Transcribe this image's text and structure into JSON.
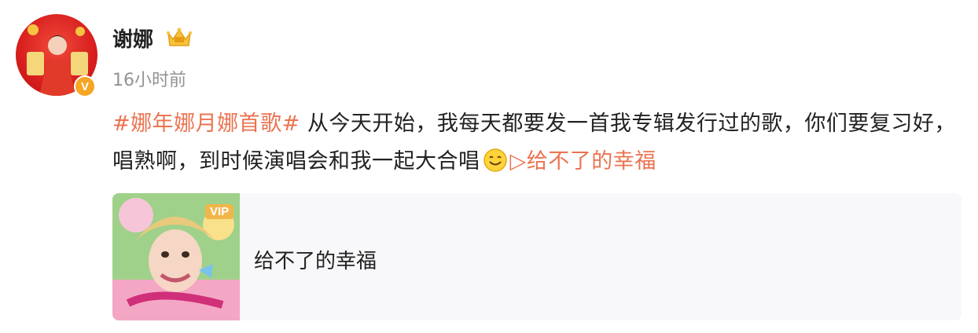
{
  "post": {
    "username": "谢娜",
    "timestamp": "16小时前",
    "hashtag": "#娜年娜月娜首歌#",
    "text_main": " 从今天开始，我每天都要发一首我专辑发行过的歌，你们要复习好，唱熟啊，到时候演唱会和我一起大合唱",
    "music_link_icon": "▷",
    "music_link_label": "给不了的幸福",
    "verified_mark": "V",
    "icons": [
      "crown-badge-icon",
      "verified-icon",
      "smile-emoji-icon",
      "play-icon"
    ]
  },
  "card": {
    "title": "给不了的幸福",
    "vip_badge": "VIP"
  },
  "colors": {
    "link_orange": "#eb7350",
    "card_background": "#f8f8fa",
    "verified_gold": "#f5a623"
  }
}
